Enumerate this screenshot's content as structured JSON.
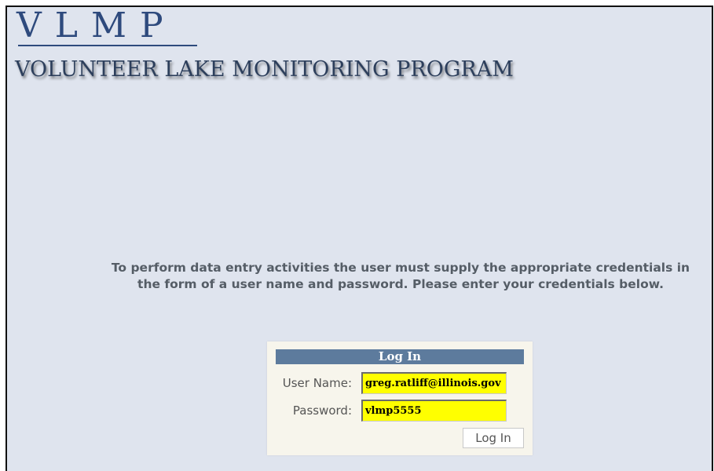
{
  "header": {
    "logo_abbreviation": "VLMP",
    "logo_full_name": "VOLUNTEER LAKE MONITORING PROGRAM"
  },
  "main": {
    "instructions": "To perform data entry activities the user must supply the appropriate credentials in the form of a user name and password. Please enter your credentials below."
  },
  "login": {
    "title": "Log In",
    "username_label": "User Name:",
    "username_value": "greg.ratliff@illinois.gov",
    "password_label": "Password:",
    "password_value": "vlmp5555",
    "submit_label": "Log In"
  },
  "colors": {
    "page_background": "#dfe4ee",
    "logo_color": "#2e4a7d",
    "login_header_background": "#5d7b9d",
    "login_panel_background": "#f7f5ec",
    "input_highlight": "#ffff00"
  }
}
